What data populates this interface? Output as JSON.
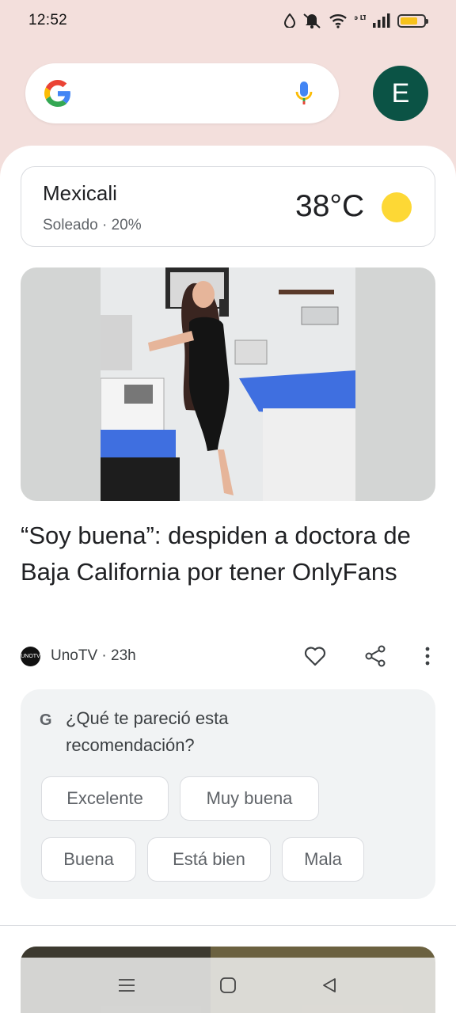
{
  "status_bar": {
    "time": "12:52",
    "icons": [
      "drop-icon",
      "mute-icon",
      "wifi-icon",
      "volte-icon",
      "signal-icon",
      "battery-icon"
    ],
    "volte_text": "Vo LTE",
    "battery_level": 0.75,
    "battery_color": "#f6c21c"
  },
  "search": {
    "logo": "google-g-icon",
    "mic": "mic-icon",
    "avatar_letter": "E",
    "avatar_color": "#0b5345"
  },
  "weather": {
    "city": "Mexicali",
    "description": "Soleado · 20%",
    "temperature": "38°C",
    "icon": "sun-icon"
  },
  "article": {
    "title": "“Soy buena”: despiden a doctora de Baja California por tener OnlyFans",
    "source": "UnoTV · 23h",
    "source_logo_text": "UNOTV",
    "actions": [
      "heart-icon",
      "share-icon",
      "more-vert-icon"
    ]
  },
  "feedback": {
    "g_letter": "G",
    "question": "¿Qué te pareció esta recomendación?",
    "options": [
      "Excelente",
      "Muy buena",
      "Buena",
      "Está bien",
      "Mala"
    ]
  },
  "nav_bar": {
    "buttons": [
      "menu-icon",
      "home-icon",
      "back-icon"
    ]
  },
  "colors": {
    "header_background": "#f3dfdc",
    "feed_background": "#ffffff",
    "chip_background": "#f1f3f4"
  }
}
